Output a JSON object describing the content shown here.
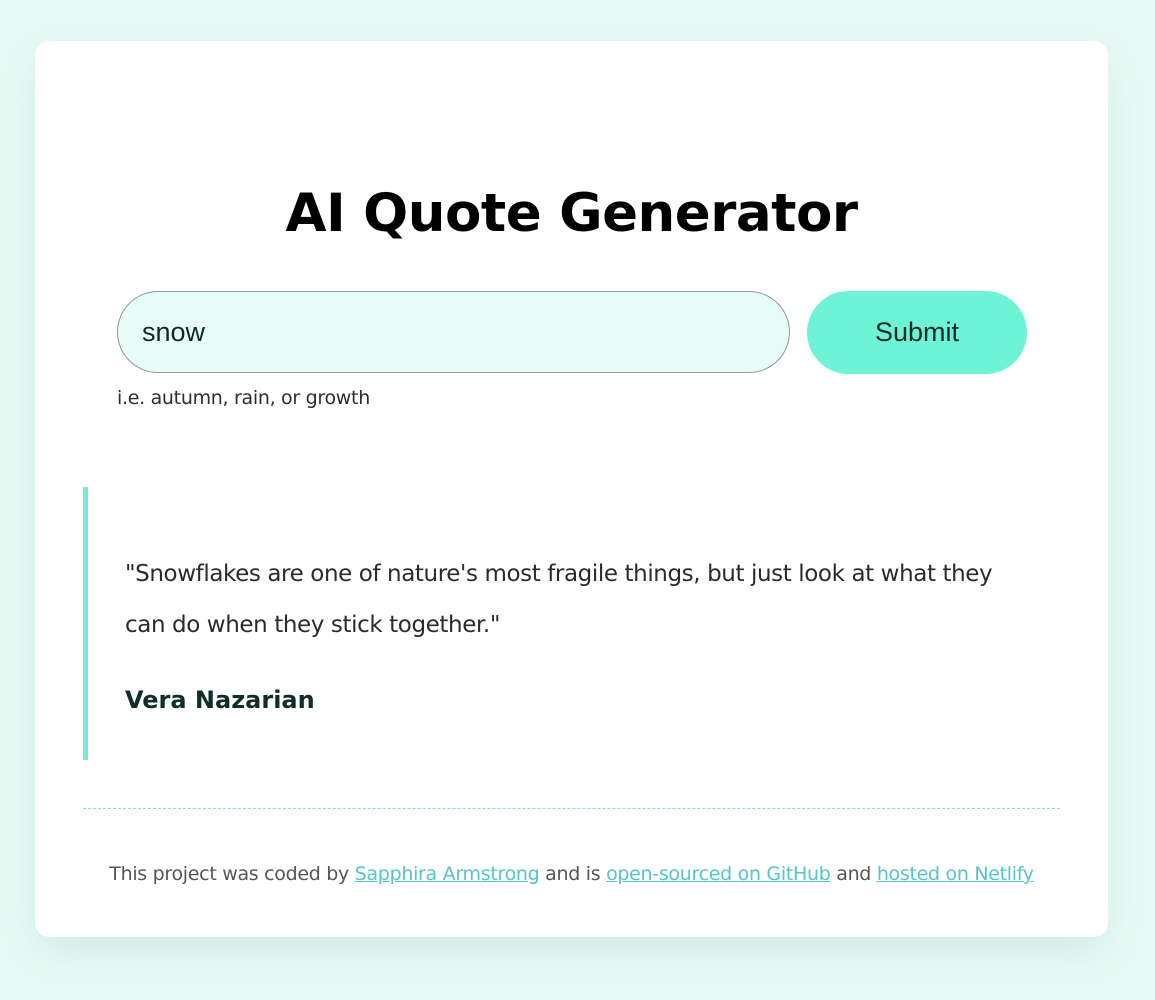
{
  "header": {
    "title": "AI Quote Generator"
  },
  "form": {
    "input_value": "snow",
    "submit_label": "Submit",
    "hint": "i.e. autumn, rain, or growth"
  },
  "quote": {
    "text": "\"Snowflakes are one of nature's most fragile things, but just look at what they can do when they stick together.\"",
    "author": "Vera Nazarian"
  },
  "footer": {
    "text_1": "This project was coded by ",
    "author_link": "Sapphira Armstrong",
    "text_2": " and is ",
    "github_link": "open-sourced on GitHub",
    "text_3": " and ",
    "netlify_link": "hosted on Netlify"
  },
  "colors": {
    "page_background": "#e8fbf6",
    "input_background": "#e8fdf8",
    "accent": "#6ef3d6",
    "quote_border": "#7ae8d4",
    "link": "#57c4cc"
  }
}
